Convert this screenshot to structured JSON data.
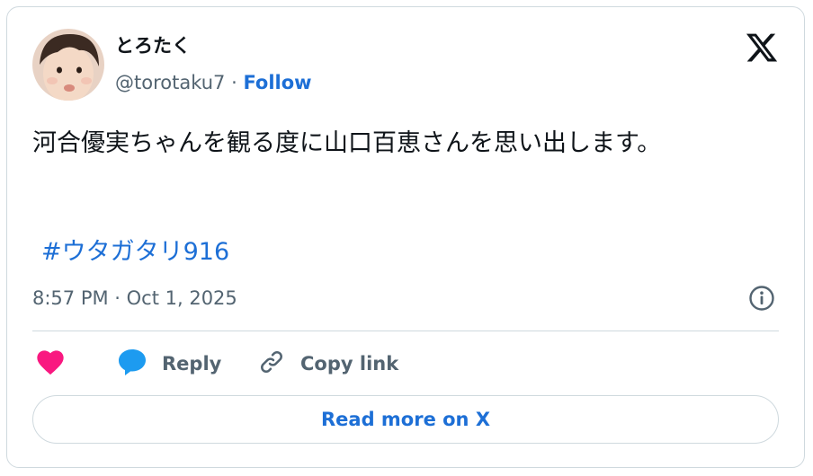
{
  "author": {
    "display_name": "とろたく",
    "handle": "@torotaku7",
    "separator": "·",
    "follow_label": "Follow"
  },
  "tweet": {
    "text": "河合優実ちゃんを観る度に山口百恵さんを思い出します。",
    "hashtag": "#ウタガタリ916",
    "timestamp": "8:57 PM · Oct 1, 2025"
  },
  "actions": {
    "like_icon": "heart-icon",
    "reply_label": "Reply",
    "copy_label": "Copy link"
  },
  "read_more_label": "Read more on X",
  "colors": {
    "link": "#1d6fd6",
    "secondary_text": "#536471",
    "heart": "#f91880",
    "reply_icon": "#1d9bf0",
    "border": "#cfd9de"
  }
}
